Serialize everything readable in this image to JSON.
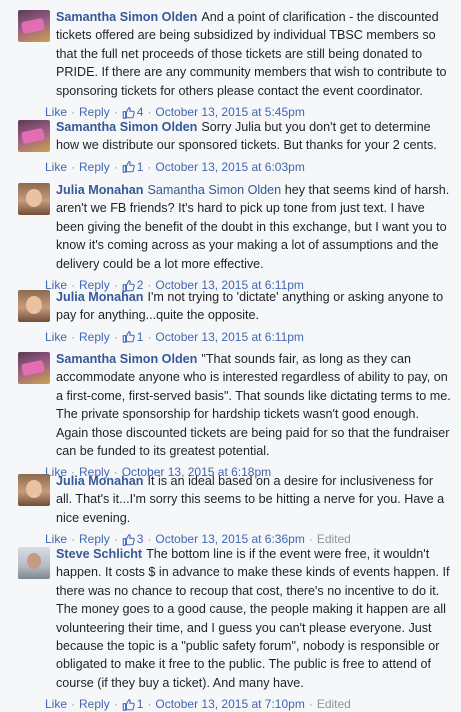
{
  "ui": {
    "like": "Like",
    "reply": "Reply",
    "sep": "·"
  },
  "comments": [
    {
      "author": "Samantha Simon Olden",
      "tag": "",
      "text": "And a point of clarification - the discounted tickets offered are being subsidized by individual TBSC members so that the full net proceeds of those tickets are still being donated to PRIDE. If there are any community members that wish to contribute to sponsoring tickets for others please contact the event coordinator.",
      "likes": "4",
      "time": "October 13, 2015 at 5:45pm",
      "edited": ""
    },
    {
      "author": "Samantha Simon Olden",
      "tag": "",
      "text": "Sorry Julia but you don't get to determine how we distribute our sponsored tickets. But thanks for your 2 cents.",
      "likes": "1",
      "time": "October 13, 2015 at 6:03pm",
      "edited": ""
    },
    {
      "author": "Julia Monahan",
      "tag": "Samantha Simon Olden",
      "text": "hey that seems kind of harsh. aren't we FB friends? It's hard to pick up tone from just text. I have been giving the benefit of the doubt in this exchange, but I want you to know it's coming across as your making a lot of assumptions and the delivery could be a lot more effective.",
      "likes": "2",
      "time": "October 13, 2015 at 6:11pm",
      "edited": ""
    },
    {
      "author": "Julia Monahan",
      "tag": "",
      "text": "I'm not trying to 'dictate' anything or asking anyone to pay for anything...quite the opposite.",
      "likes": "1",
      "time": "October 13, 2015 at 6:11pm",
      "edited": ""
    },
    {
      "author": "Samantha Simon Olden",
      "tag": "",
      "text": "\"That sounds fair, as long as they can accommodate anyone who is interested regardless of ability to pay, on a first-come, first-served basis\". That sounds like dictating terms to me. The private sponsorship for hardship tickets wasn't good enough. Again those discounted tickets are being paid for so that the fundraiser can be funded to its greatest potential.",
      "likes": "",
      "time": "October 13, 2015 at 6:18pm",
      "edited": ""
    },
    {
      "author": "Julia Monahan",
      "tag": "",
      "text": "It is an ideal based on a desire for inclusiveness for all. That's it...I'm sorry this seems to be hitting a nerve for you. Have a nice evening.",
      "likes": "3",
      "time": "October 13, 2015 at 6:36pm",
      "edited": "Edited"
    },
    {
      "author": "Steve Schlicht",
      "tag": "",
      "text": "The bottom line is if the event were free, it wouldn't happen. It costs $ in advance to make these kinds of events happen. If there was no chance to recoup that cost, there's no incentive to do it. The money goes to a good cause, the people making it happen are all volunteering their time, and I guess you can't please everyone. Just because the topic is a \"public safety forum\", nobody is responsible or obligated to make it free to the public. The public is free to attend of course (if they buy a ticket). And many have.",
      "likes": "1",
      "time": "October 13, 2015 at 7:10pm",
      "edited": "Edited"
    }
  ]
}
